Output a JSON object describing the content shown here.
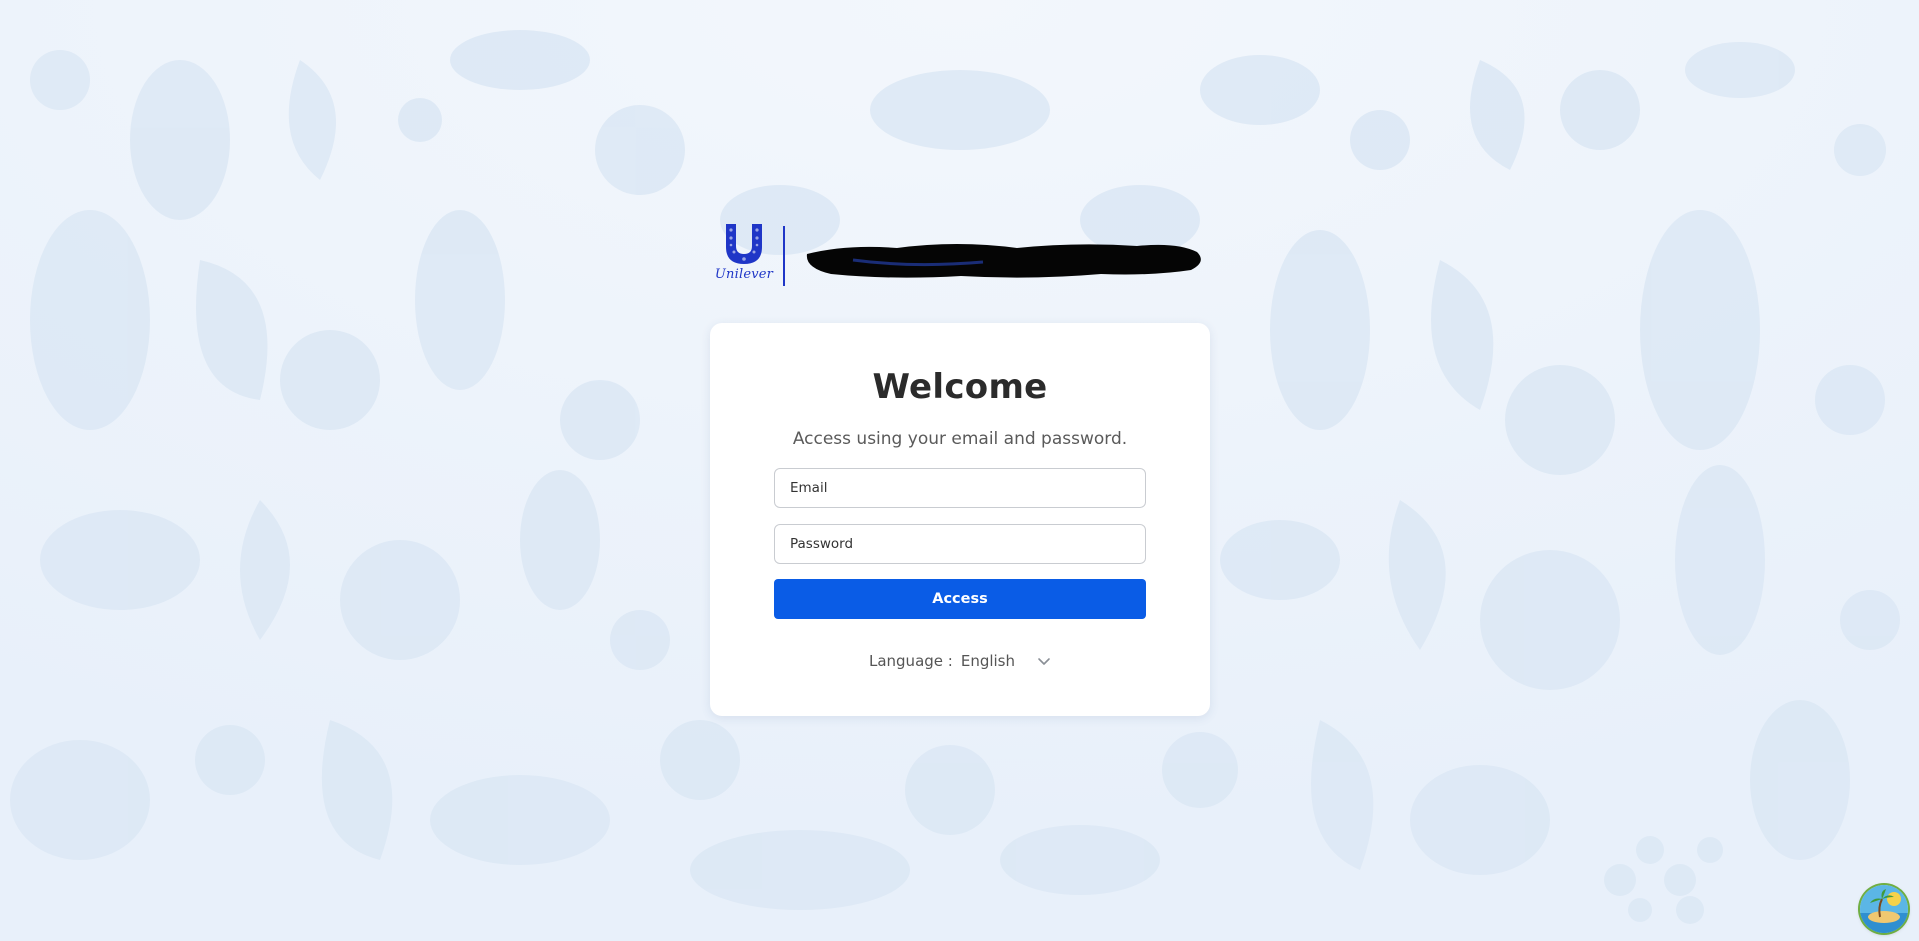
{
  "brand": {
    "logo_word": "Unilever",
    "accent_color": "#1f36c7",
    "app_name_redacted": true
  },
  "login": {
    "title": "Welcome",
    "subtitle": "Access using your email and password.",
    "email_placeholder": "Email",
    "password_placeholder": "Password",
    "submit_label": "Access",
    "submit_color": "#0a5ce6"
  },
  "language": {
    "label": "Language :",
    "selected": "English",
    "icon": "chevron-down-icon"
  },
  "assistant": {
    "icon": "island-avatar-icon"
  }
}
